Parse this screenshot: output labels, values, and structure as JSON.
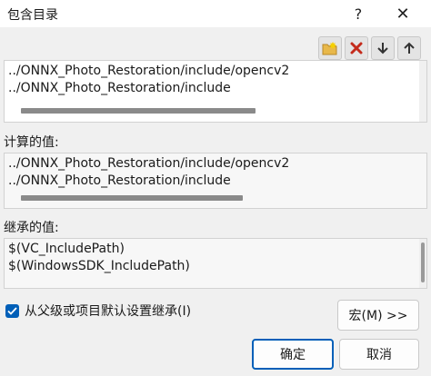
{
  "window": {
    "title": "包含目录",
    "help_label": "?",
    "close_label": "✕"
  },
  "toolbar": {
    "icons": [
      "new-folder-icon",
      "delete-icon",
      "move-down-icon",
      "move-up-icon"
    ]
  },
  "edit_list": {
    "lines": [
      "../ONNX_Photo_Restoration/include/opencv2",
      "../ONNX_Photo_Restoration/include"
    ]
  },
  "evaluated": {
    "label": "计算的值:",
    "lines": [
      "../ONNX_Photo_Restoration/include/opencv2",
      "../ONNX_Photo_Restoration/include"
    ]
  },
  "inherited": {
    "label": "继承的值:",
    "lines": [
      "$(VC_IncludePath)",
      "$(WindowsSDK_IncludePath)"
    ]
  },
  "inherit_checkbox": {
    "label": "从父级或项目默认设置继承(I)",
    "checked": true
  },
  "buttons": {
    "macro": "宏(M) >>",
    "ok": "确定",
    "cancel": "取消"
  },
  "colors": {
    "accent": "#005fb8",
    "delete_red": "#c42b1c"
  }
}
